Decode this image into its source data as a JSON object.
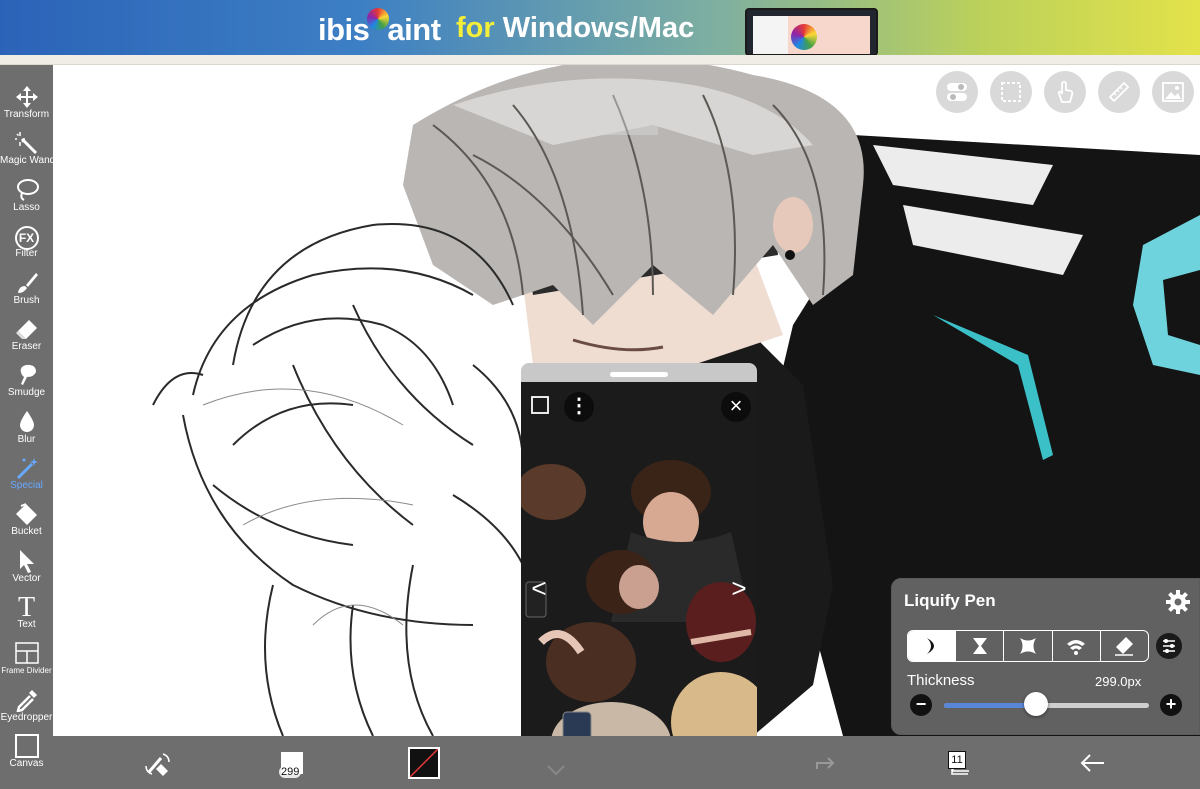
{
  "banner": {
    "logo_pre": "ibis",
    "logo_post": "aint",
    "for_text": "for",
    "platform_text": "Windows/Mac"
  },
  "toolbar": {
    "tools": [
      {
        "label": "Transform",
        "icon": "move-arrows-icon"
      },
      {
        "label": "Magic Wand",
        "icon": "magic-wand-icon"
      },
      {
        "label": "Lasso",
        "icon": "lasso-icon"
      },
      {
        "label": "Filter",
        "icon": "fx-icon"
      },
      {
        "label": "Brush",
        "icon": "brush-icon"
      },
      {
        "label": "Eraser",
        "icon": "eraser-icon"
      },
      {
        "label": "Smudge",
        "icon": "smudge-icon"
      },
      {
        "label": "Blur",
        "icon": "droplet-icon"
      },
      {
        "label": "Special",
        "icon": "special-wand-icon"
      },
      {
        "label": "Bucket",
        "icon": "bucket-icon"
      },
      {
        "label": "Vector",
        "icon": "cursor-arrow-icon"
      },
      {
        "label": "Text",
        "icon": "text-t-icon"
      },
      {
        "label": "Frame Divider",
        "icon": "frame-divider-icon"
      },
      {
        "label": "Eyedropper",
        "icon": "eyedropper-icon"
      },
      {
        "label": "Canvas",
        "icon": "canvas-square-icon"
      }
    ],
    "fx_glyph": "FX",
    "text_glyph": "T",
    "active_tool": "Special",
    "active_color": "#69a8ff"
  },
  "top_buttons": [
    "toggle-icon",
    "selection-icon",
    "hand-gesture-icon",
    "ruler-icon",
    "image-reference-icon"
  ],
  "reference_window": {
    "prev_glyph": "<",
    "next_glyph": ">",
    "close_glyph": "×",
    "menu_glyph": "⋮"
  },
  "liquify_panel": {
    "title": "Liquify Pen",
    "modes": [
      "push-mode-icon",
      "pinch-mode-icon",
      "expand-mode-icon",
      "twirl-mode-icon",
      "restore-eraser-icon"
    ],
    "selected_mode": 0,
    "thickness_label": "Thickness",
    "thickness_value": "299.0px",
    "thickness_fraction": 0.45,
    "minus": "−",
    "plus": "+"
  },
  "bottom_bar": {
    "brush_size": "299",
    "layer_count": "11",
    "primary_color": "#111111"
  }
}
